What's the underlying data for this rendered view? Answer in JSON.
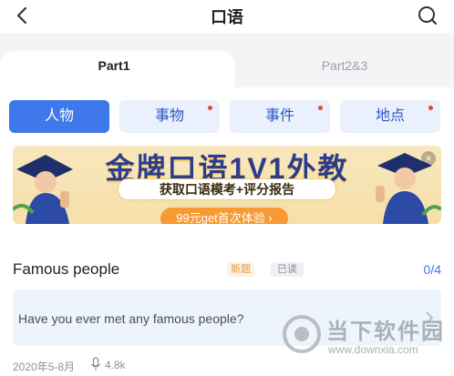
{
  "header": {
    "title": "口语"
  },
  "tabs": [
    {
      "label": "Part1",
      "active": true
    },
    {
      "label": "Part2&3",
      "active": false
    }
  ],
  "categories": [
    {
      "label": "人物",
      "active": true,
      "dot": false
    },
    {
      "label": "事物",
      "active": false,
      "dot": true
    },
    {
      "label": "事件",
      "active": false,
      "dot": true
    },
    {
      "label": "地点",
      "active": false,
      "dot": true
    }
  ],
  "banner": {
    "title": "金牌口语1V1外教",
    "subtitle": "获取口语模考+评分报告",
    "button": "99元get首次体验 ›",
    "close": "×"
  },
  "topic": {
    "title": "Famous people",
    "badge_new": "新题",
    "badge_read": "已读",
    "progress": "0/4",
    "question": "Have you ever met any famous people?",
    "date": "2020年5-8月",
    "views": "4.8k"
  },
  "watermark": {
    "text": "当下软件园",
    "url": "www.downxia.com"
  },
  "colors": {
    "accent": "#3e78ea",
    "category_bg": "#eaf1fc",
    "badge_new_text": "#e59a3d",
    "dot": "#e8443a",
    "banner_title": "#2c3d8f"
  },
  "icons": [
    "back-arrow-icon",
    "search-icon",
    "mic-icon",
    "chevron-right-icon",
    "close-icon"
  ]
}
